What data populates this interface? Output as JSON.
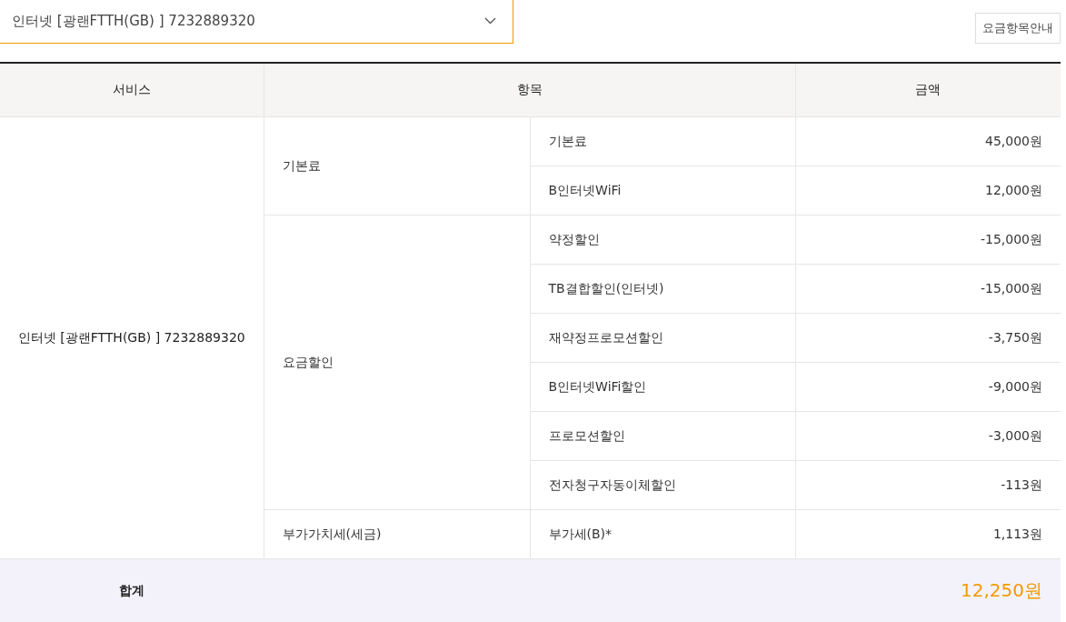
{
  "service_select": {
    "value": "인터넷 [광랜FTTH(GB) ] 7232889320"
  },
  "guide_button": "요금항목안내",
  "table": {
    "columns": [
      "서비스",
      "항목",
      "금액"
    ],
    "service": "인터넷 [광랜FTTH(GB) ] 7232889320",
    "groups": [
      {
        "name": "기본료",
        "items": [
          {
            "name": "기본료",
            "amount": "45,000원"
          },
          {
            "name": "B인터넷WiFi",
            "amount": "12,000원"
          }
        ]
      },
      {
        "name": "요금할인",
        "items": [
          {
            "name": "약정할인",
            "amount": "-15,000원"
          },
          {
            "name": "TB결합할인(인터넷)",
            "amount": "-15,000원"
          },
          {
            "name": "재약정프로모션할인",
            "amount": "-3,750원"
          },
          {
            "name": "B인터넷WiFi할인",
            "amount": "-9,000원"
          },
          {
            "name": "프로모션할인",
            "amount": "-3,000원"
          },
          {
            "name": "전자청구자동이체할인",
            "amount": "-113원"
          }
        ]
      },
      {
        "name": "부가가치세(세금)",
        "items": [
          {
            "name": "부가세(B)*",
            "amount": "1,113원"
          }
        ]
      }
    ],
    "total": {
      "label": "합계",
      "amount": "12,250원"
    }
  }
}
